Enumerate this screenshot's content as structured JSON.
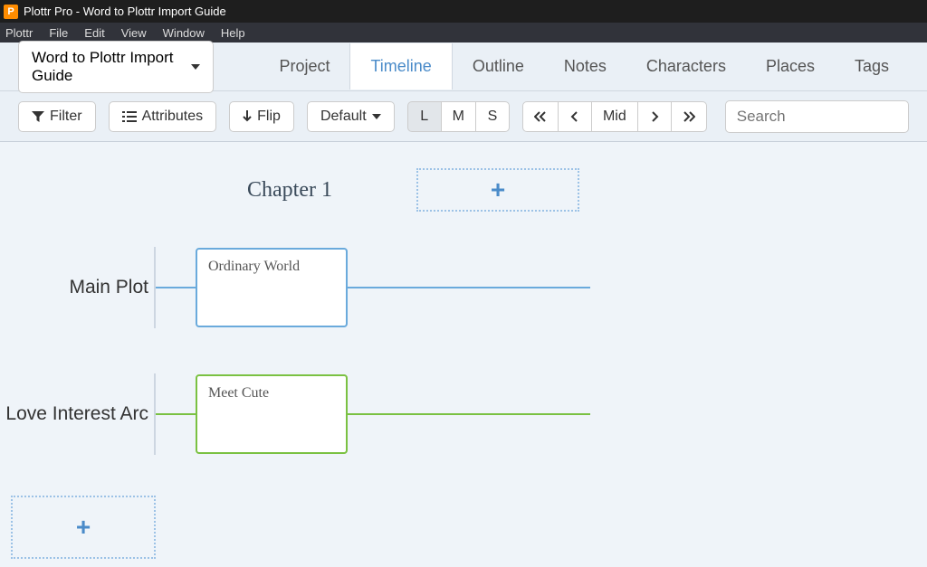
{
  "titlebar": {
    "app": "Plottr Pro",
    "doc": "Word to Plottr Import Guide"
  },
  "menubar": [
    "Plottr",
    "File",
    "Edit",
    "View",
    "Window",
    "Help"
  ],
  "book_dropdown": "Word to Plottr Import Guide",
  "nav_tabs": [
    "Project",
    "Timeline",
    "Outline",
    "Notes",
    "Characters",
    "Places",
    "Tags"
  ],
  "nav_active": "Timeline",
  "toolbar": {
    "filter": "Filter",
    "attributes": "Attributes",
    "flip": "Flip",
    "default": "Default",
    "sizes": [
      "L",
      "M",
      "S"
    ],
    "size_active": "L",
    "nav": {
      "mid": "Mid"
    },
    "search_placeholder": "Search"
  },
  "chapter": {
    "title": "Chapter 1"
  },
  "plotlines": [
    {
      "name": "Main Plot",
      "color": "blue",
      "card": "Ordinary World"
    },
    {
      "name": "Love Interest Arc",
      "color": "green",
      "card": "Meet Cute"
    }
  ]
}
